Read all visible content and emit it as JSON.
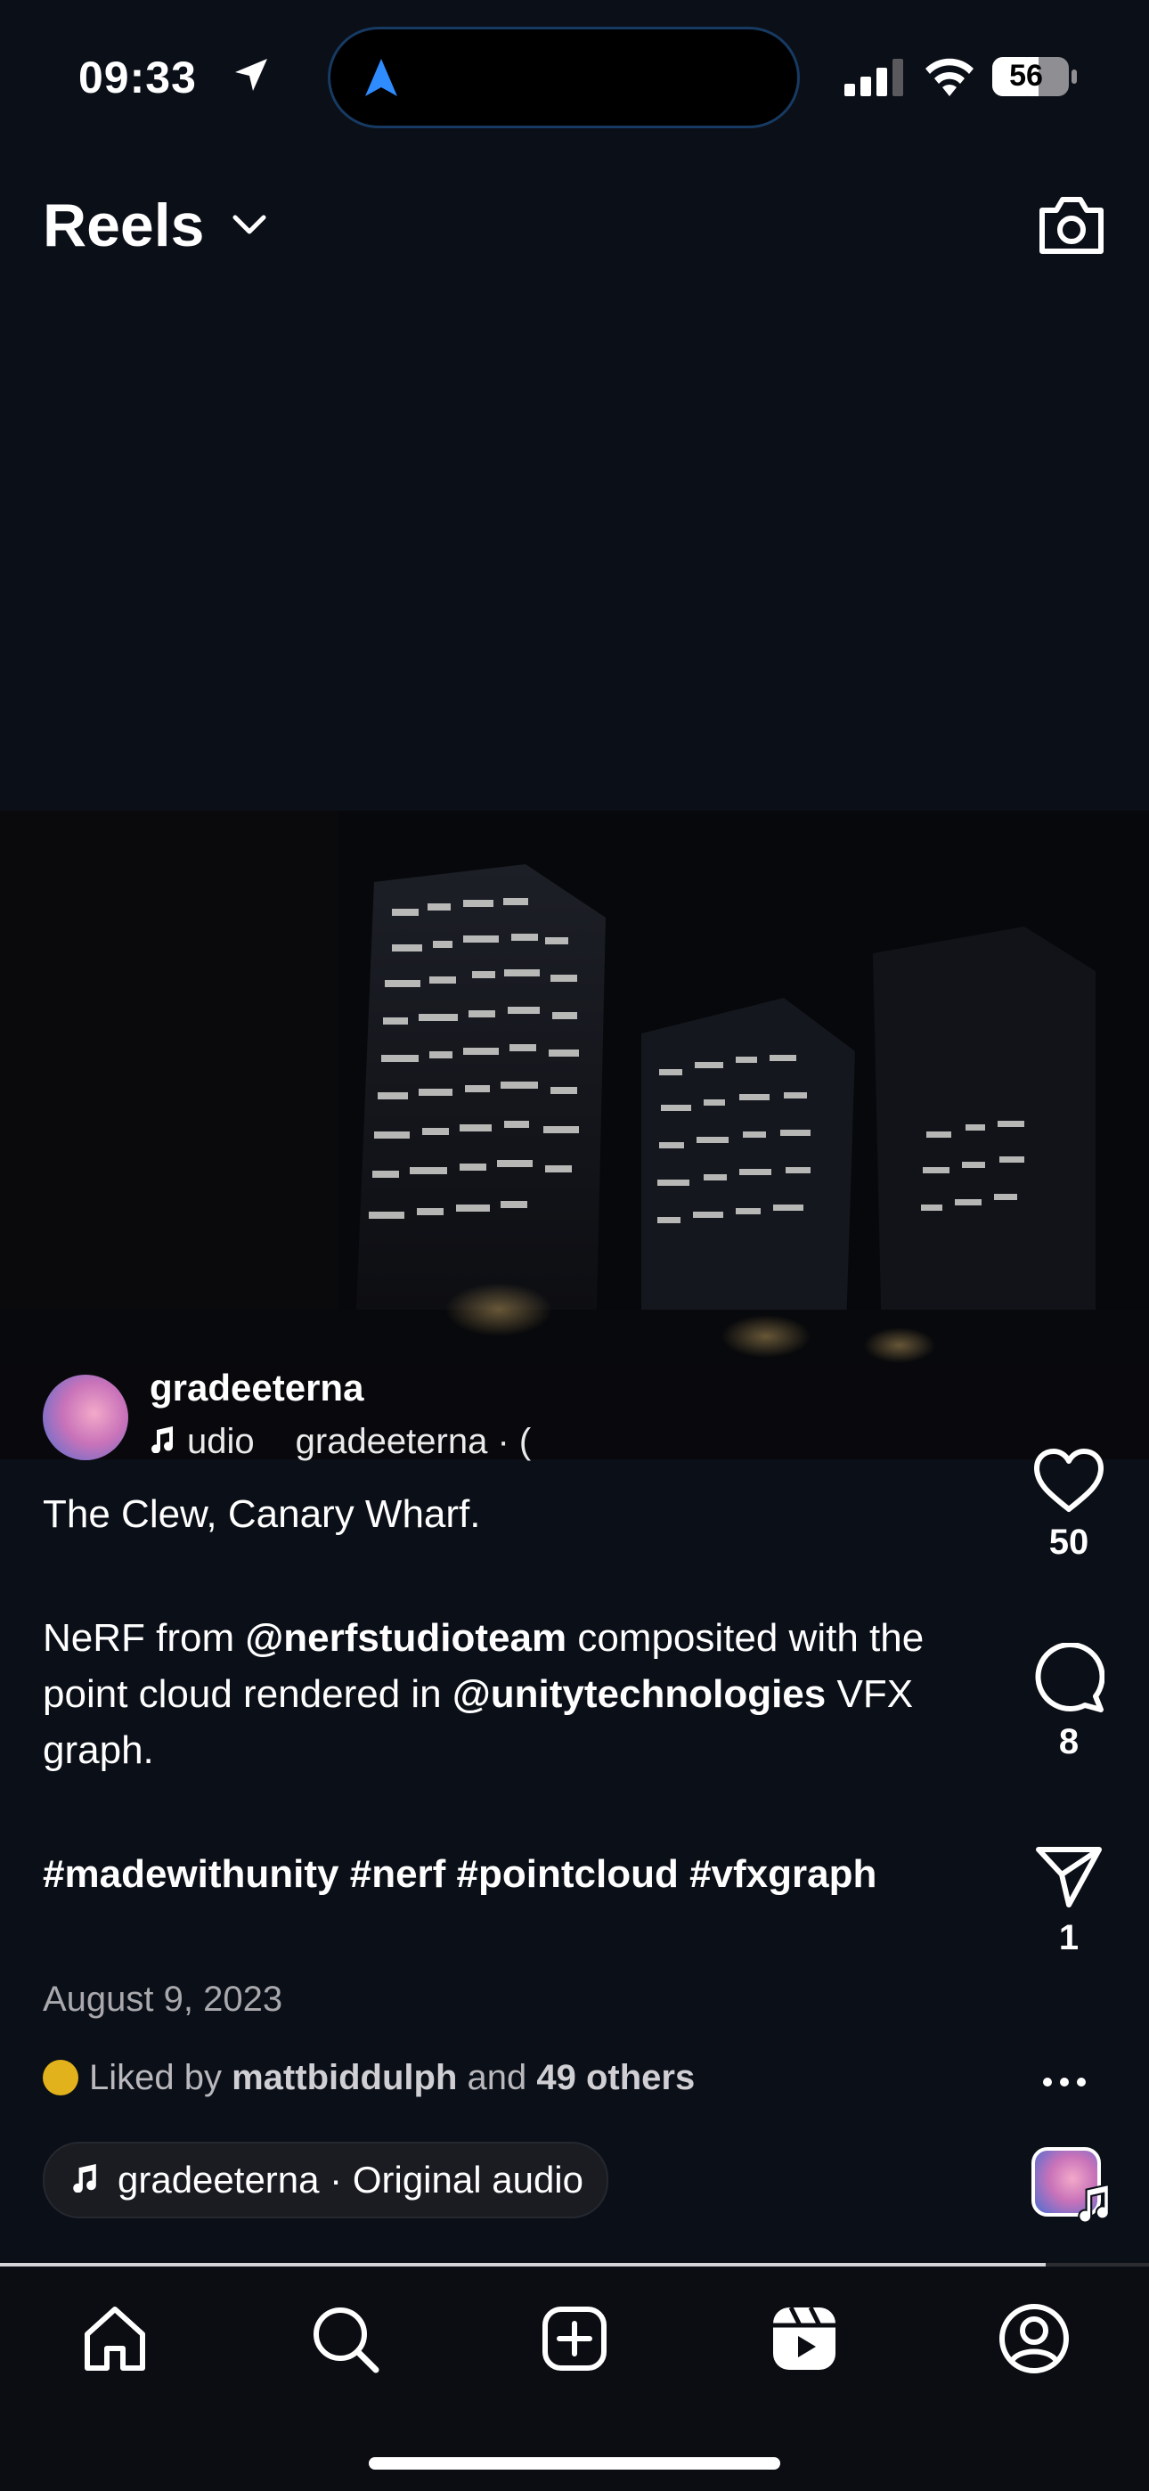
{
  "status_bar": {
    "time": "09:33",
    "battery": "56"
  },
  "header": {
    "title": "Reels"
  },
  "post": {
    "username": "gradeeterna",
    "audio_ticker_a": "udio",
    "audio_ticker_b": "gradeeterna · (",
    "caption": {
      "line1": "The Clew, Canary Wharf.",
      "p2_a": "NeRF from ",
      "p2_mention1": "@nerfstudioteam",
      "p2_b": " composited with the point cloud rendered in ",
      "p2_mention2": "@unitytechnologies",
      "p2_c": " VFX graph.",
      "hashtags": "#madewithunity #nerf #pointcloud #vfxgraph"
    },
    "date": "August 9, 2023",
    "liked_by_prefix": "Liked by ",
    "liked_by_user": "mattbiddulph",
    "liked_by_mid": " and ",
    "liked_by_others": "49 others",
    "audio_label": "gradeeterna · Original audio",
    "progress": 0.91
  },
  "actions": {
    "likes": "50",
    "comments": "8",
    "shares": "1"
  },
  "tabs": [
    "home-icon",
    "search-icon",
    "create-icon",
    "reels-icon",
    "profile-icon"
  ],
  "colors": {
    "background": "#0b0f17",
    "island_border": "#173a63",
    "nav_arrow": "#2f8cff"
  }
}
